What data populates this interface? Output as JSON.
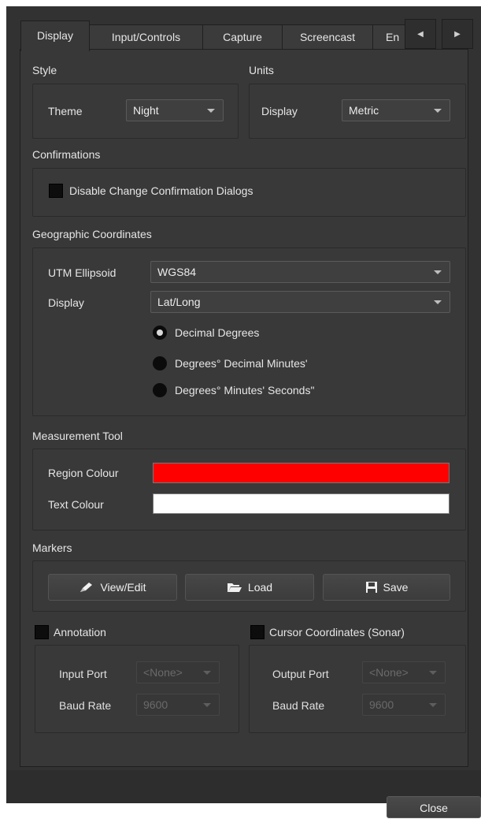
{
  "tabs": [
    {
      "label": "Display",
      "active": true
    },
    {
      "label": "Input/Controls",
      "active": false
    },
    {
      "label": "Capture",
      "active": false
    },
    {
      "label": "Screencast",
      "active": false
    },
    {
      "label": "En",
      "active": false
    }
  ],
  "style": {
    "heading": "Style",
    "theme_label": "Theme",
    "theme_value": "Night"
  },
  "units": {
    "heading": "Units",
    "display_label": "Display",
    "display_value": "Metric"
  },
  "confirmations": {
    "heading": "Confirmations",
    "disable_dialogs_label": "Disable Change Confirmation Dialogs",
    "disable_dialogs_checked": false
  },
  "geo": {
    "heading": "Geographic Coordinates",
    "ellipsoid_label": "UTM Ellipsoid",
    "ellipsoid_value": "WGS84",
    "display_label": "Display",
    "display_value": "Lat/Long",
    "formats": [
      {
        "label": "Decimal Degrees",
        "checked": true
      },
      {
        "label": "Degrees° Decimal Minutes'",
        "checked": false
      },
      {
        "label": "Degrees° Minutes' Seconds\"",
        "checked": false
      }
    ]
  },
  "measurement": {
    "heading": "Measurement Tool",
    "region_label": "Region Colour",
    "region_color": "#ff0000",
    "text_label": "Text Colour",
    "text_color": "#ffffff"
  },
  "markers": {
    "heading": "Markers",
    "view_edit": "View/Edit",
    "load": "Load",
    "save": "Save"
  },
  "annotation": {
    "label": "Annotation",
    "checked": false,
    "input_port_label": "Input Port",
    "input_port_value": "<None>",
    "baud_rate_label": "Baud Rate",
    "baud_rate_value": "9600"
  },
  "cursor": {
    "label": "Cursor Coordinates (Sonar)",
    "checked": false,
    "output_port_label": "Output Port",
    "output_port_value": "<None>",
    "baud_rate_label": "Baud Rate",
    "baud_rate_value": "9600"
  },
  "footer": {
    "close": "Close"
  }
}
